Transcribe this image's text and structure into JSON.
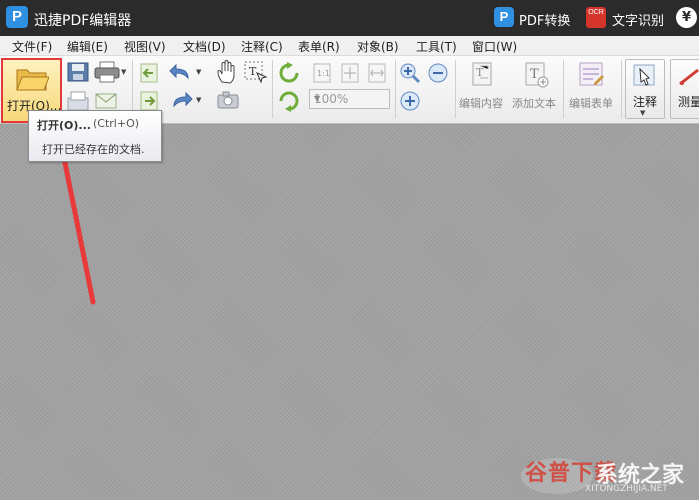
{
  "app": {
    "logo": "P",
    "title": "迅捷PDF编辑器",
    "pdf_convert_icon": "P",
    "pdf_convert_label": "PDF转换",
    "ocr_icon": "OCR",
    "ocr_label": "文字识别",
    "currency_icon": "¥"
  },
  "menu": [
    "文件(F)",
    "编辑(E)",
    "视图(V)",
    "文档(D)",
    "注释(C)",
    "表单(R)",
    "对象(B)",
    "工具(T)",
    "窗口(W)"
  ],
  "toolbar": {
    "open_label": "打开(O)...",
    "zoom_value": "100%",
    "edit_content_label": "编辑内容",
    "add_text_label": "添加文本",
    "edit_form_label": "编辑表单",
    "annotate_label": "注释",
    "measure_label": "测量"
  },
  "tooltip": {
    "title": "打开(O)...",
    "shortcut": "(Ctrl+O)",
    "description": "打开已经存在的文档."
  },
  "watermark": {
    "text": "谷普下载",
    "brand": "系统之家",
    "sub": "XITONGZHIJIA.NET"
  },
  "colors": {
    "titlebar": "#2b2b2b",
    "highlight_box": "#e23a3a",
    "arrow": "#e83a3a",
    "brand_blue": "#2f8fe0"
  }
}
